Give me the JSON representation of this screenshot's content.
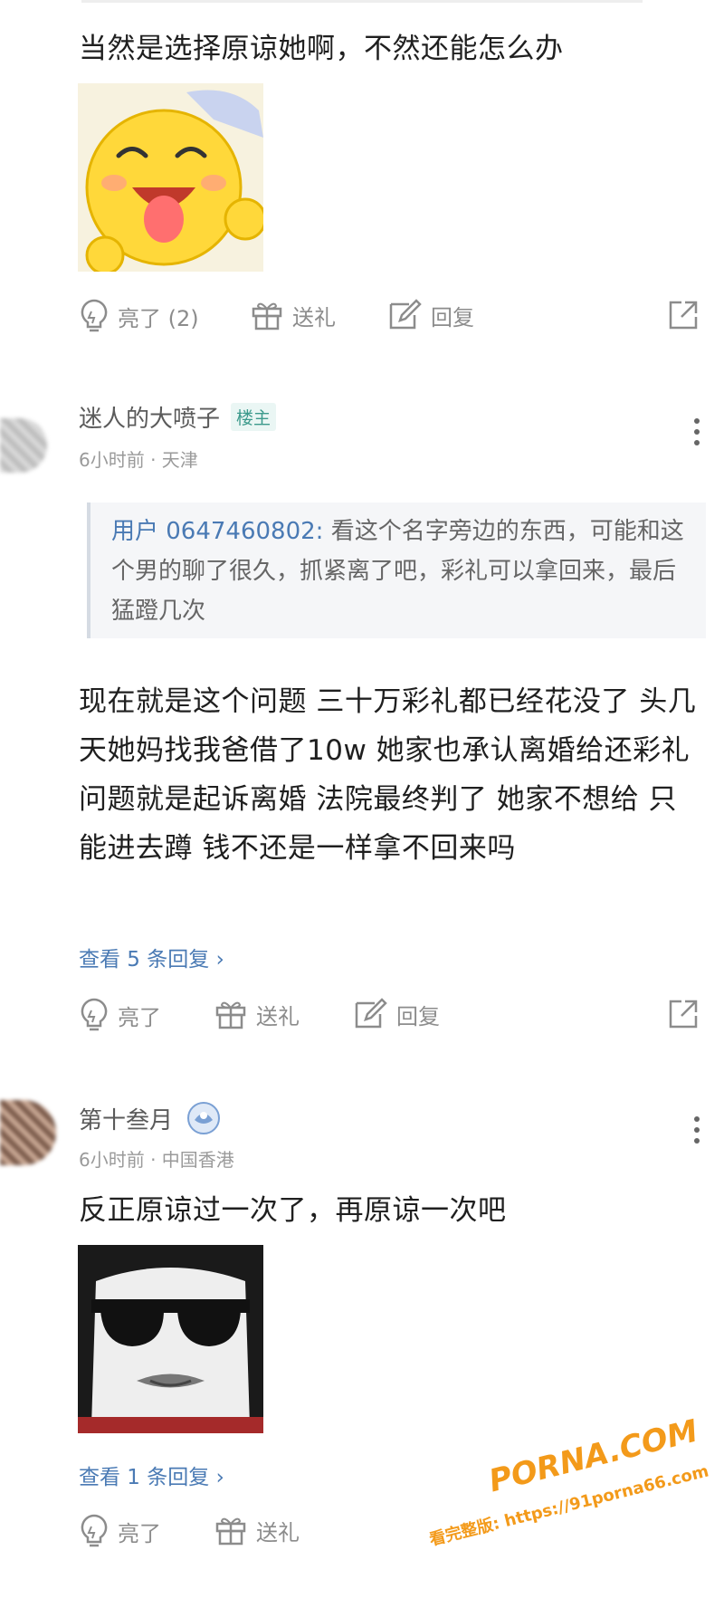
{
  "comment1": {
    "text": "当然是选择原谅她啊，不然还能怎么办",
    "actions": {
      "like": "亮了 (2)",
      "gift": "送礼",
      "reply": "回复"
    }
  },
  "comment2": {
    "user": "迷人的大喷子",
    "badge": "楼主",
    "meta": "6小时前 · 天津",
    "quote_user": "用户 0647460802:",
    "quote_text": " 看这个名字旁边的东西，可能和这个男的聊了很久，抓紧离了吧，彩礼可以拿回来，最后猛蹬几次",
    "text": "现在就是这个问题 三十万彩礼都已经花没了 头几天她妈找我爸借了10w 她家也承认离婚给还彩礼 问题就是起诉离婚 法院最终判了 她家不想给 只能进去蹲 钱不还是一样拿不回来吗",
    "view_replies": "查看 5 条回复 ›",
    "actions": {
      "like": "亮了",
      "gift": "送礼",
      "reply": "回复"
    }
  },
  "comment3": {
    "user": "第十叁月",
    "meta": "6小时前 · 中国香港",
    "text": "反正原谅过一次了，再原谅一次吧",
    "view_replies": "查看 1 条回复 ›",
    "actions": {
      "like": "亮了",
      "gift": "送礼"
    }
  },
  "watermark": {
    "brand": "PORNA.COM",
    "line": "看完整版: https://91porna66.com"
  },
  "colors": {
    "accent": "#4a7ab4",
    "badge": "#3c9a8c",
    "watermark": "#f39a1a"
  }
}
